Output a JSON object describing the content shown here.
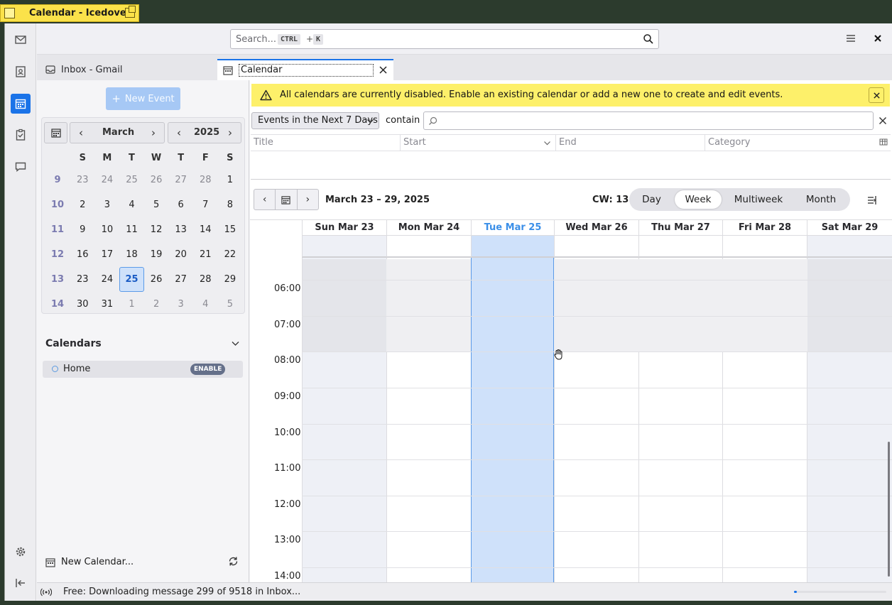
{
  "window": {
    "title": "Calendar - Icedove"
  },
  "search": {
    "placeholder": "Search...",
    "kbd_ctrl": "CTRL",
    "kbd_plus": "+",
    "kbd_key": "K"
  },
  "tabs": [
    {
      "label": "Inbox - Gmail",
      "icon": "inbox-icon"
    },
    {
      "label": "Calendar",
      "icon": "calendar-icon",
      "active": true
    }
  ],
  "sidebar": {
    "new_event_label": "New Event",
    "minimonth": {
      "month": "March",
      "year": "2025",
      "weekday_headers": [
        "S",
        "M",
        "T",
        "W",
        "T",
        "F",
        "S"
      ],
      "weeks": [
        {
          "wk": "9",
          "days": [
            "23",
            "24",
            "25",
            "26",
            "27",
            "28",
            "1"
          ]
        },
        {
          "wk": "10",
          "days": [
            "2",
            "3",
            "4",
            "5",
            "6",
            "7",
            "8"
          ]
        },
        {
          "wk": "11",
          "days": [
            "9",
            "10",
            "11",
            "12",
            "13",
            "14",
            "15"
          ]
        },
        {
          "wk": "12",
          "days": [
            "16",
            "17",
            "18",
            "19",
            "20",
            "21",
            "22"
          ]
        },
        {
          "wk": "13",
          "days": [
            "23",
            "24",
            "25",
            "26",
            "27",
            "28",
            "29"
          ]
        },
        {
          "wk": "14",
          "days": [
            "30",
            "31",
            "1",
            "2",
            "3",
            "4",
            "5"
          ]
        }
      ],
      "today": "25"
    },
    "calendars_heading": "Calendars",
    "calendars": [
      {
        "name": "Home",
        "badge": "ENABLE",
        "color": "#5c9be0"
      }
    ],
    "new_calendar_label": "New Calendar..."
  },
  "notice": {
    "text": "All calendars are currently disabled. Enable an existing calendar or add a new one to create and edit events."
  },
  "filter": {
    "selected": "Events in the Next 7 Days",
    "contain_label": "contain",
    "search_value": ""
  },
  "list_columns": [
    "Title",
    "Start",
    "End",
    "Category"
  ],
  "calview": {
    "range_label": "March 23 – 29, 2025",
    "cw_label": "CW: 13",
    "views": [
      "Day",
      "Week",
      "Multiweek",
      "Month"
    ],
    "selected_view": "Week",
    "day_headers": [
      "Sun Mar 23",
      "Mon Mar 24",
      "Tue Mar 25",
      "Wed Mar 26",
      "Thu Mar 27",
      "Fri Mar 28",
      "Sat Mar 29"
    ],
    "current_day_index": 2,
    "hours": [
      "06:00",
      "07:00",
      "08:00",
      "09:00",
      "10:00",
      "11:00",
      "12:00",
      "13:00",
      "14:00"
    ]
  },
  "status": {
    "text": "Free: Downloading message 299 of 9518 in Inbox...",
    "progress": 0.03
  },
  "colors": {
    "accent": "#1a73e8",
    "notice_bg": "#fdf06a",
    "today_column": "#cfe1fa",
    "titlebar": "#fbe24a"
  }
}
